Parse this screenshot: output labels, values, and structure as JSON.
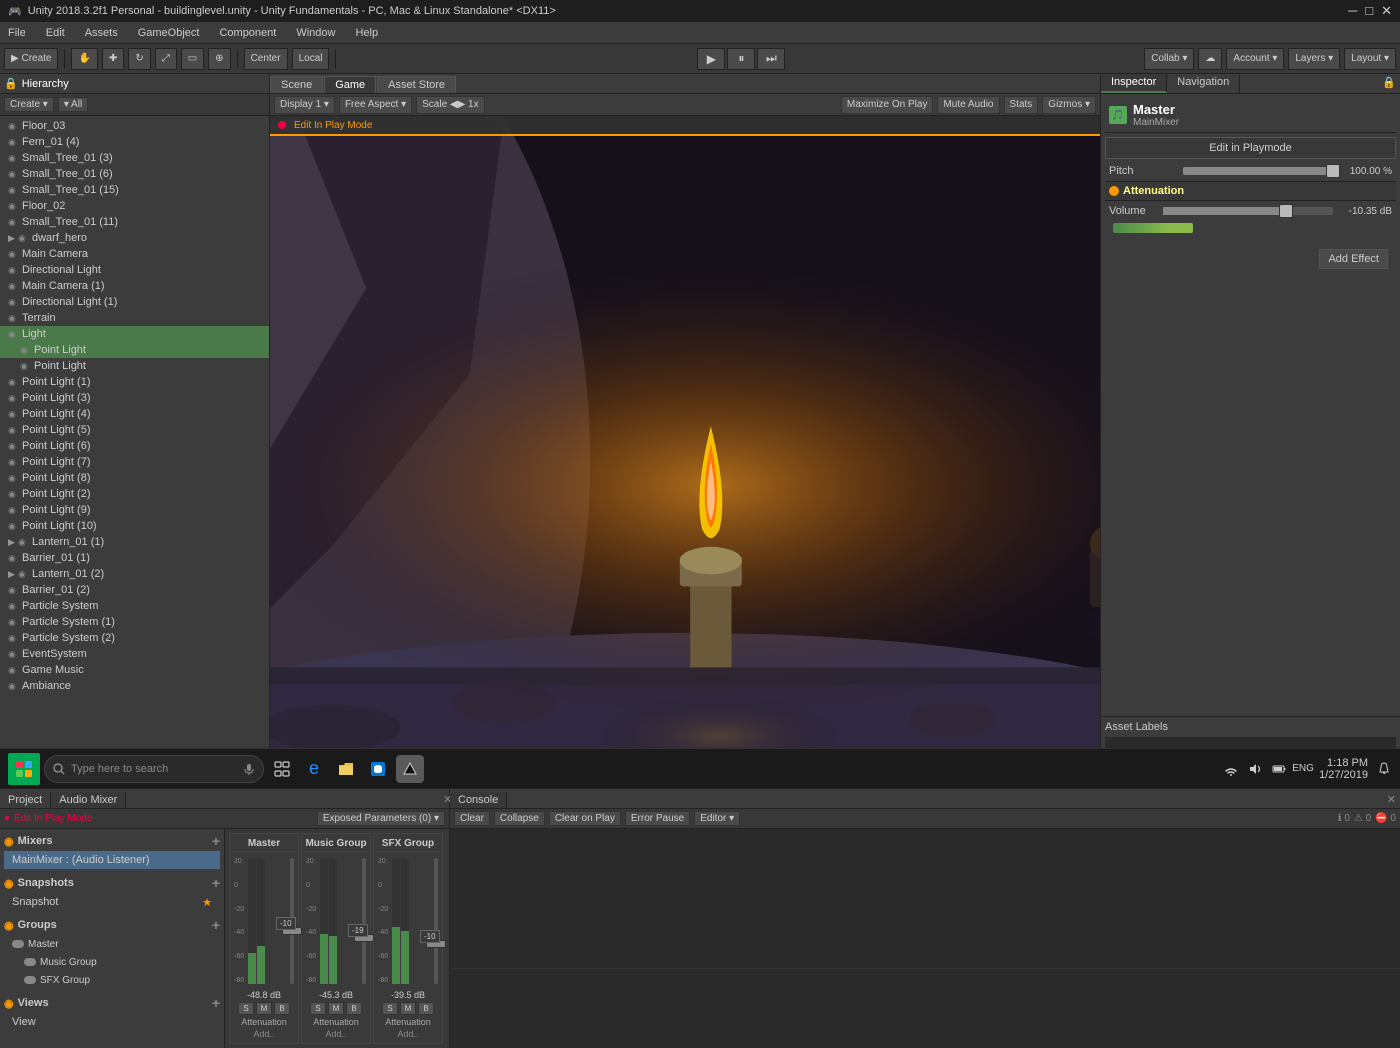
{
  "titlebar": {
    "title": "Unity 2018.3.2f1 Personal - buildinglevel.unity - Unity Fundamentals - PC, Mac & Linux Standalone* <DX11>",
    "minimize": "─",
    "maximize": "□",
    "close": "✕"
  },
  "menubar": {
    "items": [
      "File",
      "Edit",
      "Assets",
      "GameObject",
      "Component",
      "Window",
      "Help"
    ]
  },
  "toolbar": {
    "create_label": "▶ Create",
    "hand_label": "✋",
    "move_label": "✚",
    "rotate_label": "↻",
    "scale_label": "⤢",
    "rect_label": "▭",
    "transform_label": "⊕",
    "center_label": "Center",
    "local_label": "Local",
    "play_label": "▶",
    "pause_label": "⏸",
    "step_label": "⏭",
    "collab_label": "Collab ▾",
    "cloud_label": "☁",
    "account_label": "Account ▾",
    "layers_label": "Layers ▾",
    "layout_label": "Layout ▾"
  },
  "hierarchy": {
    "panel_label": "Hierarchy",
    "create_btn": "Create ▾",
    "search_placeholder": "▾ All",
    "items": [
      {
        "label": "Floor_03",
        "indent": 0,
        "has_arrow": false
      },
      {
        "label": "Fern_01 (4)",
        "indent": 0,
        "has_arrow": false
      },
      {
        "label": "Small_Tree_01 (3)",
        "indent": 0,
        "has_arrow": false
      },
      {
        "label": "Small_Tree_01 (6)",
        "indent": 0,
        "has_arrow": false
      },
      {
        "label": "Small_Tree_01 (15)",
        "indent": 0,
        "has_arrow": false
      },
      {
        "label": "Floor_02",
        "indent": 0,
        "has_arrow": false
      },
      {
        "label": "Small_Tree_01 (11)",
        "indent": 0,
        "has_arrow": false
      },
      {
        "label": "▶ dwarf_hero",
        "indent": 0,
        "has_arrow": true
      },
      {
        "label": "Main Camera",
        "indent": 0,
        "has_arrow": false
      },
      {
        "label": "Directional Light",
        "indent": 0,
        "has_arrow": false
      },
      {
        "label": "Main Camera (1)",
        "indent": 0,
        "has_arrow": false
      },
      {
        "label": "Directional Light (1)",
        "indent": 0,
        "has_arrow": false
      },
      {
        "label": "Terrain",
        "indent": 0,
        "has_arrow": false
      },
      {
        "label": "Light",
        "indent": 0,
        "has_arrow": false,
        "selected": true
      },
      {
        "label": "Point Light",
        "indent": 1,
        "has_arrow": false,
        "selected": true
      },
      {
        "label": "Point Light",
        "indent": 1,
        "has_arrow": false
      },
      {
        "label": "Point Light (1)",
        "indent": 0,
        "has_arrow": false
      },
      {
        "label": "Point Light (3)",
        "indent": 0,
        "has_arrow": false
      },
      {
        "label": "Point Light (4)",
        "indent": 0,
        "has_arrow": false
      },
      {
        "label": "Point Light (5)",
        "indent": 0,
        "has_arrow": false
      },
      {
        "label": "Point Light (6)",
        "indent": 0,
        "has_arrow": false
      },
      {
        "label": "Point Light (7)",
        "indent": 0,
        "has_arrow": false
      },
      {
        "label": "Point Light (8)",
        "indent": 0,
        "has_arrow": false
      },
      {
        "label": "Point Light (2)",
        "indent": 0,
        "has_arrow": false
      },
      {
        "label": "Point Light (9)",
        "indent": 0,
        "has_arrow": false
      },
      {
        "label": "Point Light (10)",
        "indent": 0,
        "has_arrow": false
      },
      {
        "label": "▶ Lantern_01 (1)",
        "indent": 0,
        "has_arrow": true
      },
      {
        "label": "Barrier_01 (1)",
        "indent": 0,
        "has_arrow": false
      },
      {
        "label": "▶ Lantern_01 (2)",
        "indent": 0,
        "has_arrow": true
      },
      {
        "label": "Barrier_01 (2)",
        "indent": 0,
        "has_arrow": false
      },
      {
        "label": "Particle System",
        "indent": 0,
        "has_arrow": false
      },
      {
        "label": "Particle System (1)",
        "indent": 0,
        "has_arrow": false
      },
      {
        "label": "Particle System (2)",
        "indent": 0,
        "has_arrow": false
      },
      {
        "label": "EventSystem",
        "indent": 0,
        "has_arrow": false
      },
      {
        "label": "Game Music",
        "indent": 0,
        "has_arrow": false
      },
      {
        "label": "Ambiance",
        "indent": 0,
        "has_arrow": false
      }
    ]
  },
  "game_view": {
    "tabs": [
      "Scene",
      "Game",
      "Asset Store"
    ],
    "active_tab": "Game",
    "display_label": "Display 1",
    "aspect_label": "Free Aspect",
    "scale_label": "Scale",
    "scale_value": "1x",
    "maximize_label": "Maximize On Play",
    "mute_label": "Mute Audio",
    "stats_label": "Stats",
    "gizmos_label": "Gizmos ▾",
    "edit_mode_label": "Edit In Play Mode"
  },
  "inspector": {
    "tabs": [
      "Inspector",
      "Navigation"
    ],
    "active_tab": "Inspector",
    "master_title": "Master",
    "master_sub": "MainMixer",
    "edit_play_btn": "Edit in Playmode",
    "pitch_label": "Pitch",
    "pitch_value": "100.00 %",
    "pitch_slider_pct": 100,
    "attenuation_label": "Attenuation",
    "volume_label": "Volume",
    "volume_value": "-10.35 dB",
    "volume_slider_pct": 70,
    "add_effect_btn": "Add Effect"
  },
  "audio_mixer": {
    "tabs": [
      "Project",
      "Audio Mixer"
    ],
    "active_tab": "Audio Mixer",
    "edit_mode_label": "Edit In Play Mode",
    "exposed_params_label": "Exposed Parameters (0) ▾",
    "sections": {
      "mixers": {
        "header": "Mixers",
        "items": [
          {
            "label": "MainMixer : (Audio Listener)",
            "selected": true
          }
        ]
      },
      "snapshots": {
        "header": "Snapshots",
        "items": [
          {
            "label": "Snapshot",
            "selected": false
          }
        ]
      },
      "groups": {
        "header": "Groups",
        "items": [
          {
            "label": "Master",
            "selected": false,
            "indent": 0
          },
          {
            "label": "Music Group",
            "selected": false,
            "indent": 1
          },
          {
            "label": "SFX Group",
            "selected": false,
            "indent": 1
          }
        ]
      },
      "views": {
        "header": "Views",
        "items": [
          {
            "label": "View",
            "selected": false
          }
        ]
      }
    },
    "channels": [
      {
        "name": "Master",
        "db_value": "-48.8 dB",
        "fader_pct": 60,
        "vu1_pct": 25,
        "vu2_pct": 30,
        "label": "Attenuation",
        "add_label": "Add..",
        "btns": [
          "S",
          "M",
          "B"
        ]
      },
      {
        "name": "Music Group",
        "db_value": "-45.3 dB",
        "fader_pct": 65,
        "vu1_pct": 40,
        "vu2_pct": 38,
        "label": "Attenuation",
        "add_label": "Add..",
        "btns": [
          "S",
          "M",
          "B"
        ]
      },
      {
        "name": "SFX Group",
        "db_value": "-39.5 dB",
        "fader_pct": 70,
        "vu1_pct": 45,
        "vu2_pct": 42,
        "label": "Attenuation",
        "add_label": "Add..",
        "btns": [
          "S",
          "M",
          "B"
        ]
      }
    ]
  },
  "console": {
    "tab_label": "Console",
    "btns": [
      "Clear",
      "Collapse",
      "Clear on Play",
      "Error Pause",
      "Editor ▾"
    ],
    "icons": [
      "0",
      "0",
      "0"
    ]
  },
  "asset_labels": {
    "label": "Asset Labels"
  },
  "taskbar": {
    "search_placeholder": "Type here to search",
    "time": "1:18 PM",
    "date": "1/27/2019",
    "lang": "ENG"
  }
}
